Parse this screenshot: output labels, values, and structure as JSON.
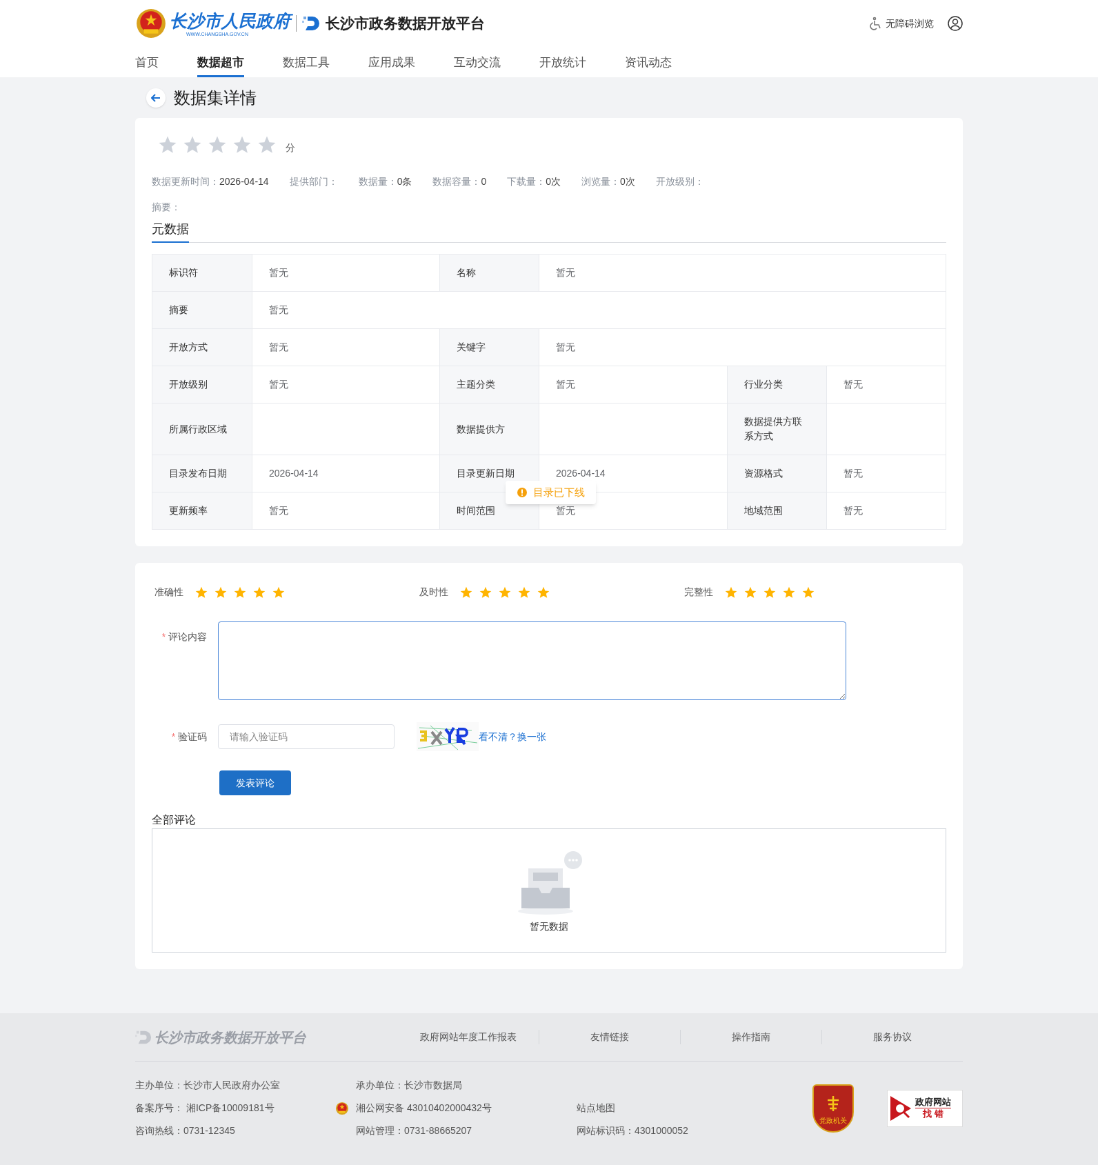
{
  "header": {
    "gov_name": "长沙市人民政府",
    "gov_url": "WWW.CHANGSHA.GOV.CN",
    "platform": "长沙市政务数据开放平台",
    "accessibility": "无障碍浏览"
  },
  "nav": [
    {
      "label": "首页",
      "selected": false
    },
    {
      "label": "数据超市",
      "selected": true
    },
    {
      "label": "数据工具",
      "selected": false
    },
    {
      "label": "应用成果",
      "selected": false
    },
    {
      "label": "互动交流",
      "selected": false
    },
    {
      "label": "开放统计",
      "selected": false
    },
    {
      "label": "资讯动态",
      "selected": false
    }
  ],
  "page_title": "数据集详情",
  "score": {
    "stars": 0,
    "unit": "分"
  },
  "meta": [
    {
      "label": "数据更新时间：",
      "value": "2026-04-14"
    },
    {
      "label": "提供部门："
    },
    {
      "label": "数据量：",
      "value": "0条"
    },
    {
      "label": "数据容量：",
      "value": "0"
    },
    {
      "label": "下载量：",
      "value": "0次"
    },
    {
      "label": "浏览量：",
      "value": "0次"
    },
    {
      "label": "开放级别："
    }
  ],
  "summary_label": "摘要：",
  "tabs": [
    {
      "label": "元数据",
      "selected": true
    }
  ],
  "metadata_rows": [
    [
      {
        "label": "标识符",
        "value": "暂无"
      },
      {
        "label": "名称",
        "value": "暂无"
      }
    ],
    [
      {
        "label": "摘要",
        "value": "暂无"
      }
    ],
    [
      {
        "label": "开放方式",
        "value": "暂无"
      },
      {
        "label": "关键字",
        "value": "暂无"
      }
    ],
    [
      {
        "label": "开放级别",
        "value": "暂无"
      },
      {
        "label": "主题分类",
        "value": "暂无"
      },
      {
        "label": "行业分类",
        "value": "暂无"
      }
    ],
    [
      {
        "label": "所属行政区域"
      },
      {
        "label": "数据提供方"
      },
      {
        "label": "数据提供方联系方式"
      }
    ],
    [
      {
        "label": "目录发布日期",
        "value": "2026-04-14"
      },
      {
        "label": "目录更新日期",
        "value": "2026-04-14"
      },
      {
        "label": "资源格式",
        "value": "暂无"
      }
    ],
    [
      {
        "label": "更新频率",
        "value": "暂无"
      },
      {
        "label": "时间范围",
        "value": "暂无"
      },
      {
        "label": "地域范围",
        "value": "暂无"
      }
    ]
  ],
  "toast": {
    "text": "目录已下线"
  },
  "ratings": [
    {
      "label": "准确性",
      "stars": 5
    },
    {
      "label": "及时性",
      "stars": 5
    },
    {
      "label": "完整性",
      "stars": 5
    }
  ],
  "comment_form": {
    "comment_label": "评论内容",
    "captcha_label": "验证码",
    "required_mark": "*",
    "captcha_placeholder": "请输入验证码",
    "refresh_link": "看不清？换一张",
    "submit": "发表评论"
  },
  "comments": {
    "title": "全部评论",
    "empty": "暂无数据"
  },
  "footer": {
    "logo": "长沙市政务数据开放平台",
    "links": [
      "政府网站年度工作报表",
      "友情链接",
      "操作指南",
      "服务协议"
    ],
    "info": [
      [
        "主办单位：长沙市人民政府办公室",
        "备案序号： 湘ICP备10009181号",
        "咨询热线：0731-12345"
      ],
      [
        "承办单位：长沙市数据局",
        "湘公网安备 43010402000432号",
        "网站管理：0731-88665207"
      ],
      [
        "站点地图",
        "网站标识码：4301000052"
      ]
    ],
    "badge": "党政机关",
    "error_box": [
      "政府网站",
      "找 错"
    ]
  }
}
